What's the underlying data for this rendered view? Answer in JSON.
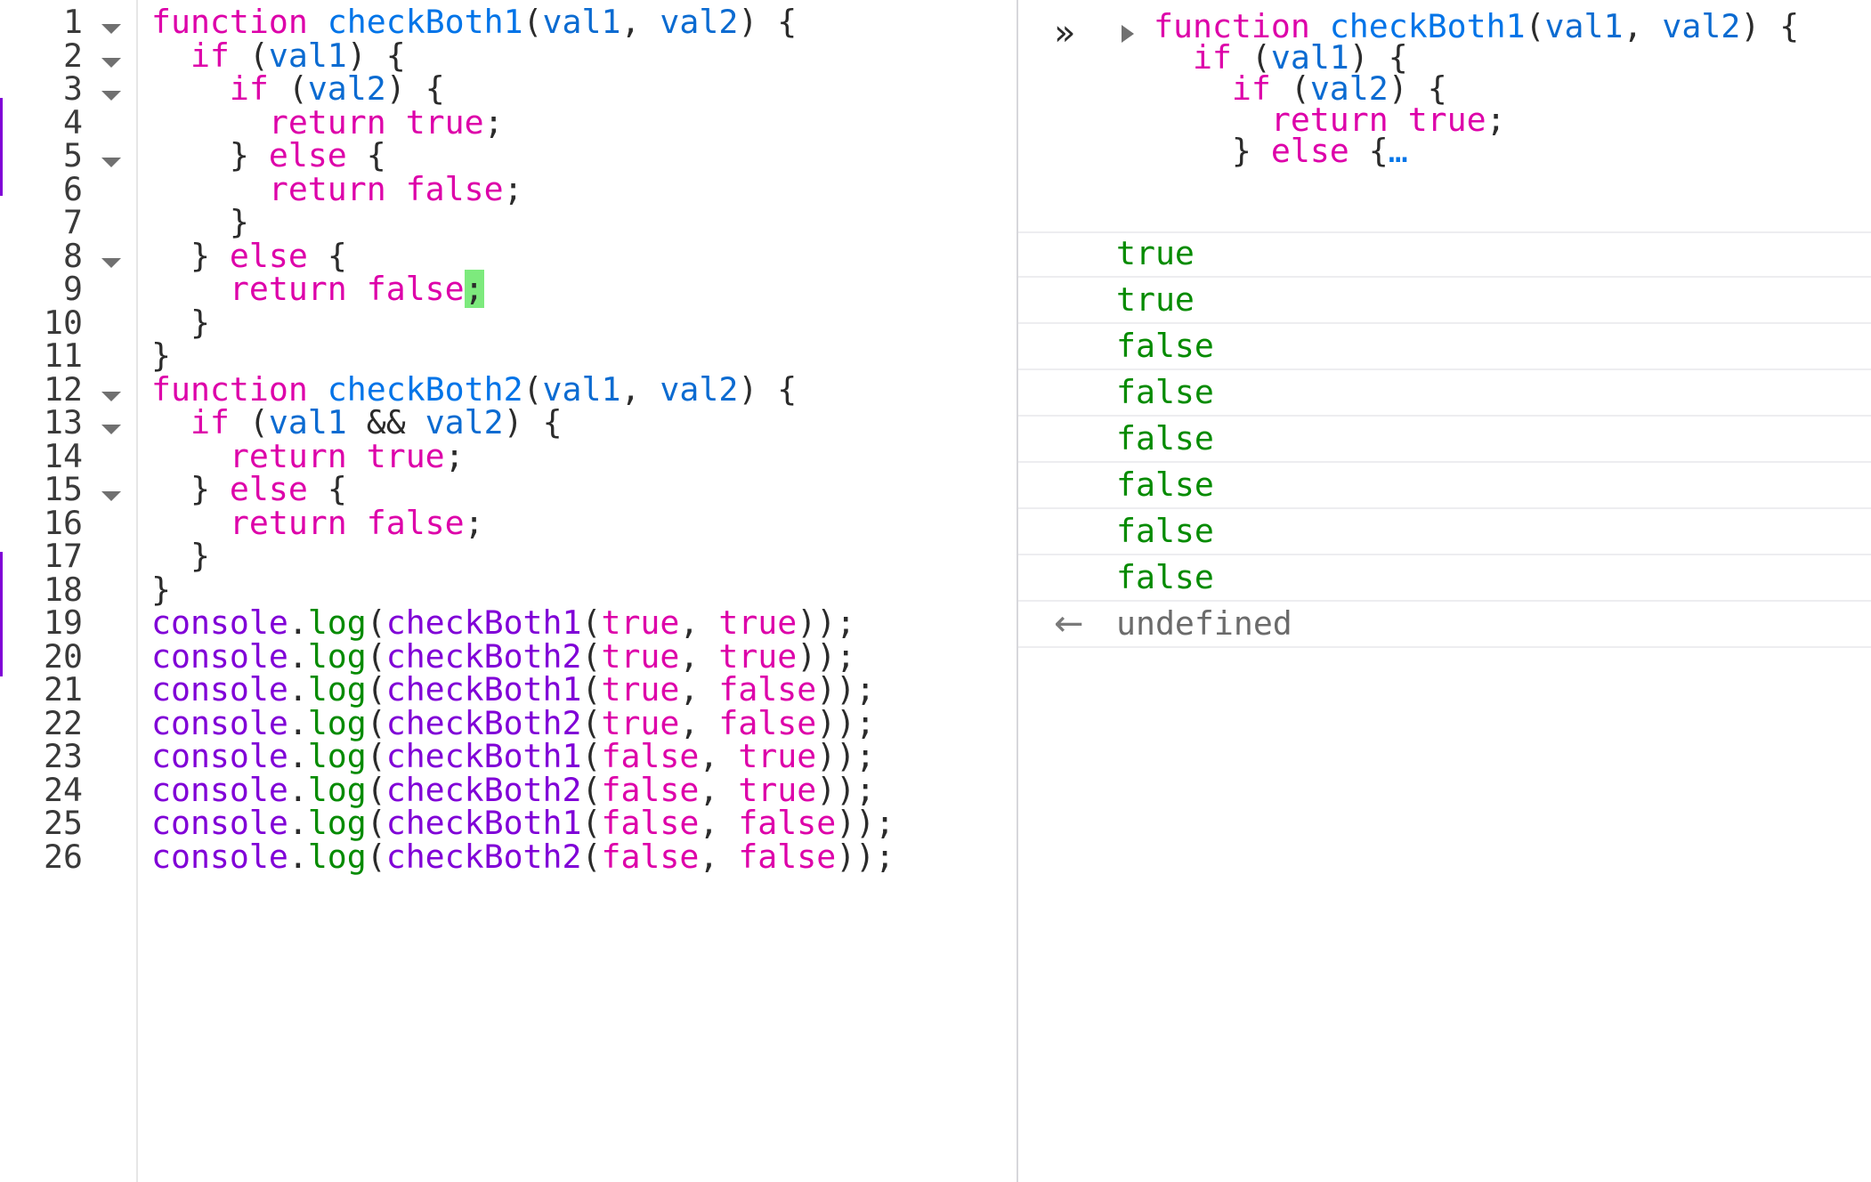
{
  "editor": {
    "line_numbers": [
      "1",
      "2",
      "3",
      "4",
      "5",
      "6",
      "7",
      "8",
      "9",
      "10",
      "11",
      "12",
      "13",
      "14",
      "15",
      "16",
      "17",
      "18",
      "19",
      "20",
      "21",
      "22",
      "23",
      "24",
      "25",
      "26"
    ],
    "lines": [
      "function checkBoth1(val1, val2) {",
      "  if (val1) {",
      "    if (val2) {",
      "      return true;",
      "    } else {",
      "      return false;",
      "    }",
      "  } else {",
      "    return false;",
      "  }",
      "}",
      "function checkBoth2(val1, val2) {",
      "  if (val1 && val2) {",
      "    return true;",
      "  } else {",
      "    return false;",
      "  }",
      "}",
      "console.log(checkBoth1(true, true));",
      "console.log(checkBoth2(true, true));",
      "console.log(checkBoth1(true, false));",
      "console.log(checkBoth2(true, false));",
      "console.log(checkBoth1(false, true));",
      "console.log(checkBoth2(false, true));",
      "console.log(checkBoth1(false, false));",
      "console.log(checkBoth2(false, false));"
    ],
    "foldable_lines": [
      1,
      2,
      3,
      5,
      8,
      12,
      13,
      15
    ]
  },
  "console": {
    "input_lines": [
      "function checkBoth1(val1, val2) {",
      "  if (val1) {",
      "    if (val2) {",
      "      return true;",
      "    } else {…"
    ],
    "results": [
      "true",
      "true",
      "false",
      "false",
      "false",
      "false",
      "false",
      "false"
    ],
    "return_value": "undefined",
    "icons": {
      "prompt": "prompt-chevrons-icon",
      "expand": "expand-triangle-icon",
      "return": "return-arrow-icon"
    }
  },
  "colors": {
    "keyword": "#dd00a9",
    "definition": "#0074e8",
    "variable": "#0b6bd1",
    "object": "#8000d7",
    "call": "#058b00",
    "result": "#058b00",
    "cursor_highlight": "#7dea7d"
  }
}
